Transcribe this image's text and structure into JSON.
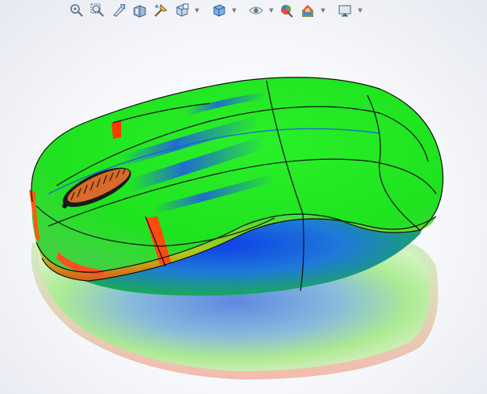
{
  "app": {
    "view": "graphics-area"
  },
  "toolbar": {
    "buttons": [
      {
        "icon": "zoom-to-fit-icon"
      },
      {
        "icon": "zoom-to-area-icon"
      },
      {
        "icon": "previous-view-icon"
      },
      {
        "icon": "section-view-icon"
      },
      {
        "icon": "dynamic-annotation-icon"
      },
      {
        "icon": "view-orientation-icon",
        "dropdown": true
      },
      {
        "icon": "display-style-icon",
        "dropdown": true
      },
      {
        "icon": "hide-show-items-icon",
        "dropdown": true
      },
      {
        "icon": "edit-appearance-icon"
      },
      {
        "icon": "apply-scene-icon",
        "dropdown": true
      },
      {
        "icon": "view-settings-icon",
        "dropdown": true
      }
    ]
  },
  "analysis": {
    "type": "curvature-display",
    "colors": {
      "high": "#ff3a00",
      "mid": "#22ee22",
      "low": "#1a4fe6"
    }
  }
}
